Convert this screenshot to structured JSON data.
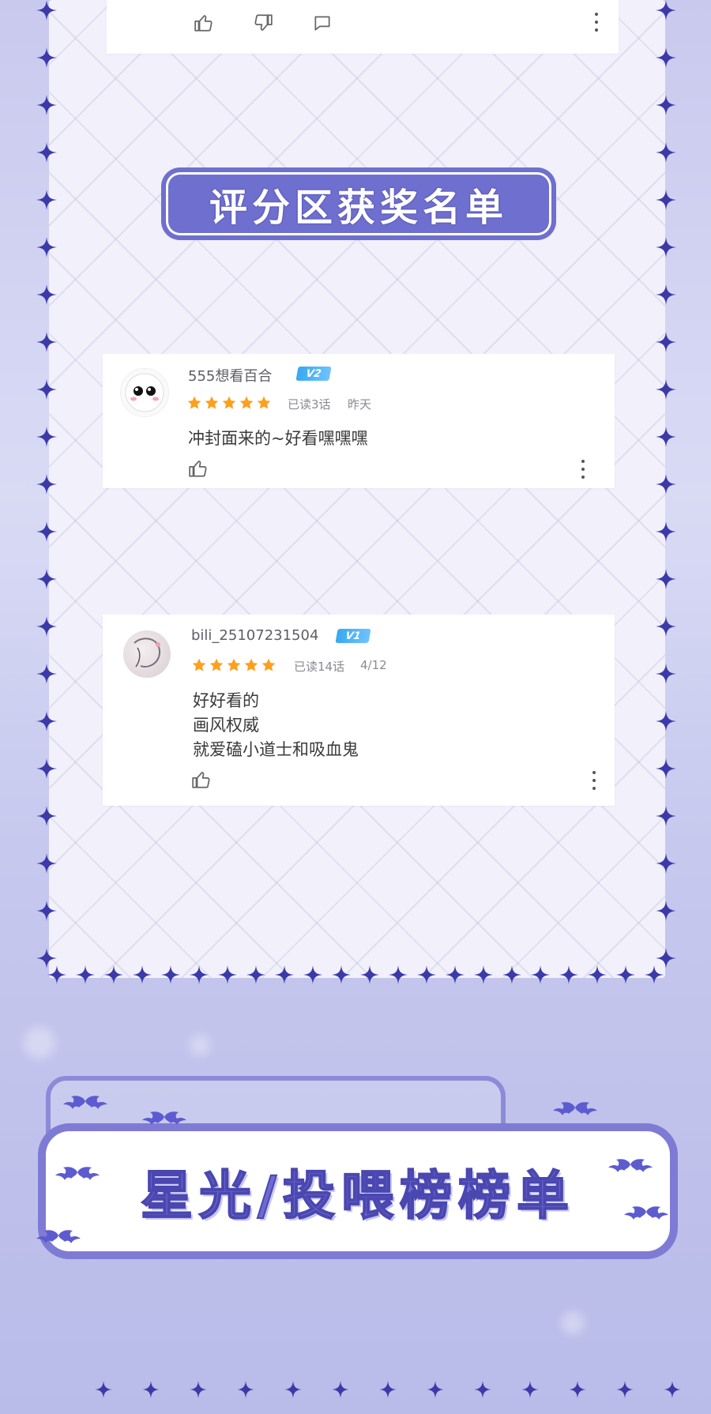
{
  "top_card": {
    "icons": [
      "thumbs-up-icon",
      "thumbs-down-icon",
      "comment-icon",
      "more-vertical-icon"
    ]
  },
  "section_title": "评分区获奖名单",
  "comments": [
    {
      "username": "555想看百合",
      "level": "V2",
      "rating": 5,
      "read": "已读3话",
      "time": "昨天",
      "text": "冲封面来的~好看嘿嘿嘿"
    },
    {
      "username": "bili_25107231504",
      "level": "V1",
      "rating": 5,
      "read": "已读14话",
      "time": "4/12",
      "text": "好好看的\n画风权威\n就爱磕小道士和吸血鬼"
    }
  ],
  "bottom_banner": "星光/投喂榜榜单",
  "colors": {
    "accent": "#6f6fcf",
    "star_rating": "#ff9f1c",
    "badge": "#38a8f0",
    "border_star": "#3c3aa8"
  }
}
